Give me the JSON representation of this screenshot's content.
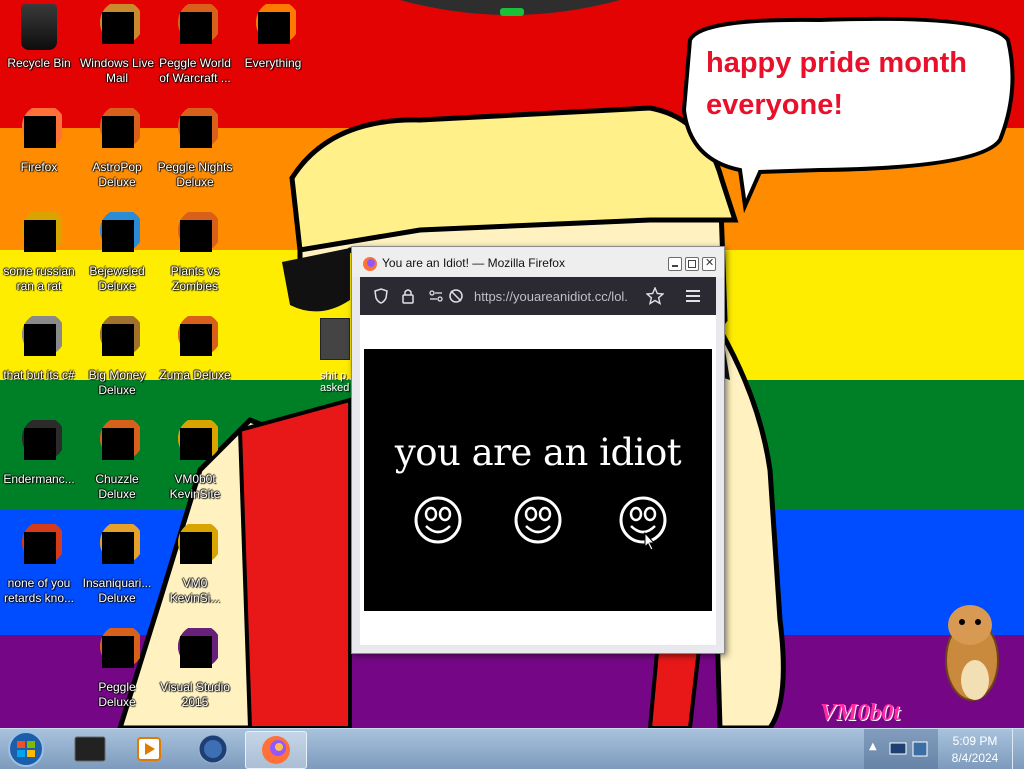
{
  "wallpaper": {
    "stripe_colors": [
      "#e40303",
      "#ff8c00",
      "#ffed00",
      "#008026",
      "#004dff",
      "#750787"
    ],
    "speech_bubble_text": "happy pride month everyone!",
    "watermark_text": "VM0b0t",
    "partial_icon_label": "shit p... asked"
  },
  "desktop_icons": [
    {
      "label": "Recycle Bin",
      "icon": "recycle-bin-icon"
    },
    {
      "label": "Windows Live\nMail",
      "icon": "mail-icon"
    },
    {
      "label": "Peggle World\nof Warcraft ...",
      "icon": "game-icon"
    },
    {
      "label": "Everything",
      "icon": "search-app-icon"
    },
    {
      "label": "Firefox",
      "icon": "firefox-icon"
    },
    {
      "label": "AstroPop\nDeluxe",
      "icon": "game-icon"
    },
    {
      "label": "Peggle Nights\nDeluxe",
      "icon": "game-icon"
    },
    {
      "label": "some russian\nran a rat",
      "icon": "app-icon"
    },
    {
      "label": "Bejeweled\nDeluxe",
      "icon": "gem-icon"
    },
    {
      "label": "Plants vs\nZombies",
      "icon": "game-icon"
    },
    {
      "label": "that but its c#",
      "icon": "folder-icon"
    },
    {
      "label": "Big Money\nDeluxe",
      "icon": "money-bag-icon"
    },
    {
      "label": "Zuma Deluxe",
      "icon": "game-icon"
    },
    {
      "label": "Endermanc...",
      "icon": "terminal-icon"
    },
    {
      "label": "Chuzzle\nDeluxe",
      "icon": "game-icon"
    },
    {
      "label": "VM0b0t\nKevinSite",
      "icon": "app-icon"
    },
    {
      "label": "none of you\nretards kno...",
      "icon": "browser-icon"
    },
    {
      "label": "Insaniquari...\nDeluxe",
      "icon": "fish-icon"
    },
    {
      "label": "VM0\nKevinSi...",
      "icon": "app-icon"
    },
    {
      "label": "Peggle Deluxe",
      "icon": "game-icon"
    },
    {
      "label": "Visual Studio\n2015",
      "icon": "visual-studio-icon"
    }
  ],
  "browser": {
    "window_title": "You are an Idiot! — Mozilla Firefox",
    "url": "https://youareanidiot.cc/lol.",
    "page_text": "you are an idiot"
  },
  "taskbar": {
    "time": "5:09 PM",
    "date": "8/4/2024",
    "apps": [
      "terminal",
      "media-player",
      "browser",
      "firefox"
    ]
  }
}
